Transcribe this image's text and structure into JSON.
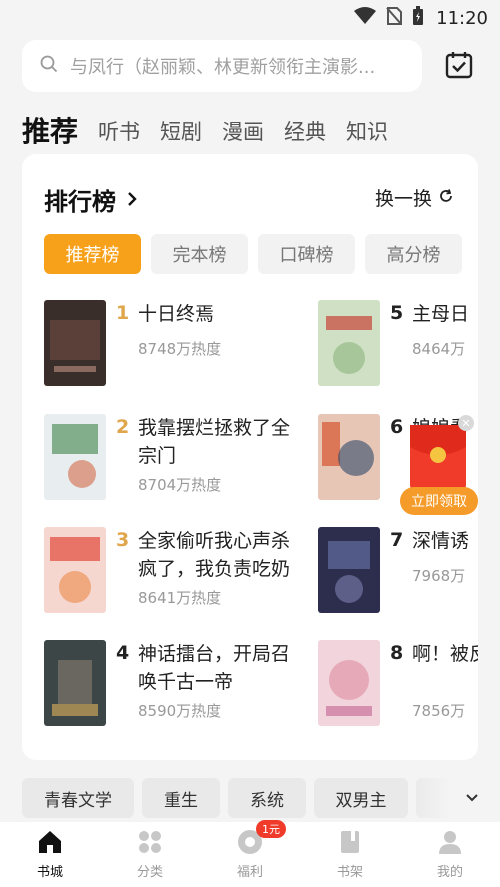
{
  "status": {
    "time": "11:20"
  },
  "search": {
    "placeholder": "与凤行（赵丽颖、林更新领衔主演影..."
  },
  "top_tabs": [
    "推荐",
    "听书",
    "短剧",
    "漫画",
    "经典",
    "知识"
  ],
  "ranking": {
    "title": "排行榜",
    "refresh_label": "换一换",
    "tabs": [
      "推荐榜",
      "完本榜",
      "口碑榜",
      "高分榜"
    ],
    "books": [
      {
        "rank": "1",
        "title": "十日终焉",
        "heat": "8748万热度",
        "cover_color": "#3a2e2a"
      },
      {
        "rank": "2",
        "title": "我靠摆烂拯救了全宗门",
        "heat": "8704万热度",
        "cover_color": "#e8eef0"
      },
      {
        "rank": "3",
        "title": "全家偷听我心声杀疯了，我负责吃奶",
        "heat": "8641万热度",
        "cover_color": "#f6d7cf"
      },
      {
        "rank": "4",
        "title": "神话擂台，开局召唤千古一帝",
        "heat": "8590万热度",
        "cover_color": "#3c4646"
      },
      {
        "rank": "5",
        "title": "主母日",
        "heat": "8464万",
        "cover_color": "#cfe0c4"
      },
      {
        "rank": "6",
        "title": "娘娘看",
        "heat": "",
        "cover_color": "#e8c6b6"
      },
      {
        "rank": "7",
        "title": "深情诱",
        "heat": "7968万",
        "cover_color": "#2d2e4d"
      },
      {
        "rank": "8",
        "title": "啊！被反派们",
        "heat": "7856万",
        "cover_color": "#f1d4dc"
      }
    ]
  },
  "red_packet": {
    "button_label": "立即领取"
  },
  "categories": [
    "青春文学",
    "重生",
    "系统",
    "双男主"
  ],
  "bottom_nav": [
    {
      "label": "书城",
      "active": true
    },
    {
      "label": "分类",
      "active": false
    },
    {
      "label": "福利",
      "active": false,
      "badge": "1元"
    },
    {
      "label": "书架",
      "active": false
    },
    {
      "label": "我的",
      "active": false
    }
  ],
  "colors": {
    "accent": "#f7a11a",
    "rank_top": "#e0a64c",
    "packet_red": "#f03a2a"
  }
}
